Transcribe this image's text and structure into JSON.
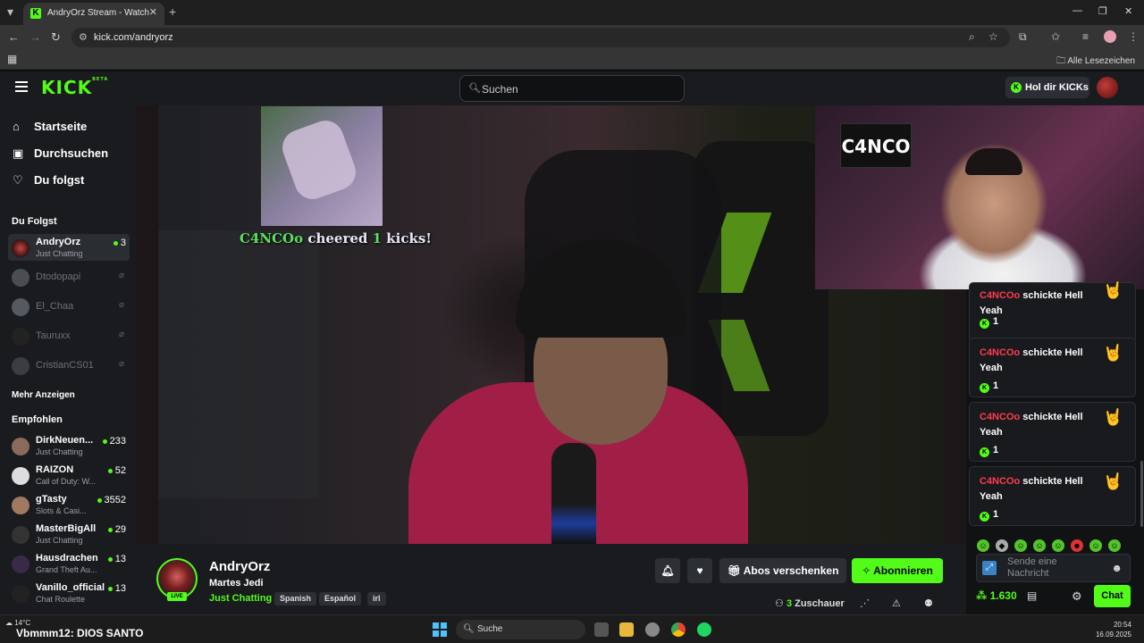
{
  "browser": {
    "tab_title": "AndryOrz Stream - Watch Live on Kick",
    "url": "kick.com/andryorz",
    "bookmarks_label": "Alle Lesezeichen"
  },
  "kick": {
    "logo": "KICK",
    "logo_badge": "BETA",
    "search_placeholder": "Suchen",
    "get_kicks": "Hol dir KICKs"
  },
  "sidebar": {
    "nav": [
      {
        "label": "Startseite",
        "icon": "home-icon"
      },
      {
        "label": "Durchsuchen",
        "icon": "browse-icon"
      },
      {
        "label": "Du folgst",
        "icon": "heart-icon"
      }
    ],
    "following_heading": "Du Folgst",
    "following": [
      {
        "name": "AndryOrz",
        "category": "Just Chatting",
        "viewers": "3",
        "live": true
      },
      {
        "name": "Dtodopapi",
        "live": false
      },
      {
        "name": "El_Chaa",
        "live": false
      },
      {
        "name": "Tauruxx",
        "live": false
      },
      {
        "name": "CristianCS01",
        "live": false
      }
    ],
    "show_more": "Mehr Anzeigen",
    "recommended_heading": "Empfohlen",
    "recommended": [
      {
        "name": "DirkNeuen...",
        "category": "Just Chatting",
        "viewers": "233"
      },
      {
        "name": "RAIZON",
        "category": "Call of Duty: W...",
        "viewers": "52"
      },
      {
        "name": "gTasty",
        "category": "Slots & Casi...",
        "viewers": "3552"
      },
      {
        "name": "MasterBigAll",
        "category": "Just Chatting",
        "viewers": "29"
      },
      {
        "name": "Hausdrachen",
        "category": "Grand Theft Au...",
        "viewers": "13"
      },
      {
        "name": "Vanillo_official",
        "category": "Chat Roulette",
        "viewers": "13"
      }
    ]
  },
  "video": {
    "cheer_user": "C4NCOo",
    "cheer_mid": " cheered ",
    "cheer_amount": "1",
    "cheer_end": " kicks!",
    "webcam_logo": "C4NCO"
  },
  "chat": {
    "messages": [
      {
        "user": "C4NCOo",
        "text": " schickte Hell Yeah",
        "amount": "1"
      },
      {
        "user": "C4NCOo",
        "text": " schickte Hell Yeah",
        "amount": "1"
      },
      {
        "user": "C4NCOo",
        "text": " schickte Hell Yeah",
        "amount": "1"
      },
      {
        "user": "C4NCOo",
        "text": " schickte Hell Yeah",
        "amount": "1"
      }
    ],
    "input_placeholder": "Sende eine Nachricht",
    "points": "1.630",
    "chat_button": "Chat"
  },
  "stream": {
    "channel": "AndryOrz",
    "title": "Martes Jedi",
    "category": "Just Chatting",
    "live_badge": "LIVE",
    "tags": [
      "Spanish",
      "Español",
      "irl"
    ],
    "gift_subs": "Abos verschenken",
    "subscribe": "Abonnieren",
    "viewers_count": "3",
    "viewers_label": " Zuschauer"
  },
  "taskbar": {
    "temperature": "14°C",
    "now_playing": "Vbmmm12: DIOS SANTO",
    "search_placeholder": "Suche",
    "time": "20:54",
    "date": "16.09.2025"
  }
}
